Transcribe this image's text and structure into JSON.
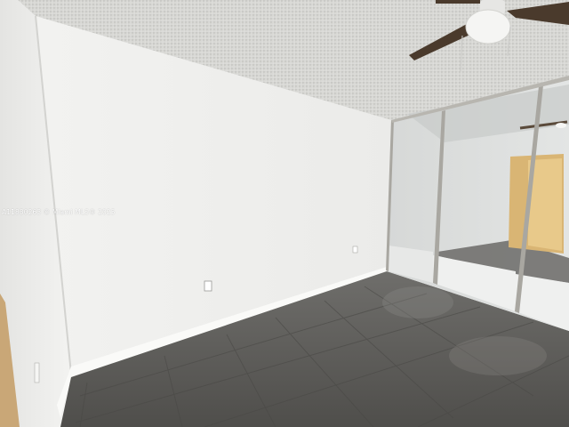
{
  "photo": {
    "watermark": "A11830263 © Miami MLS® 2025"
  },
  "colors": {
    "ceiling": "#d9d9d6",
    "wall_left": "#f1f1ef",
    "wall_back": "#f4f4f2",
    "floor": "#5c5b58",
    "mirror": "#dcdedd",
    "frame": "#b8b6b0",
    "fan_blade": "#4a3a2c",
    "fan_light": "#f3f3f1"
  }
}
